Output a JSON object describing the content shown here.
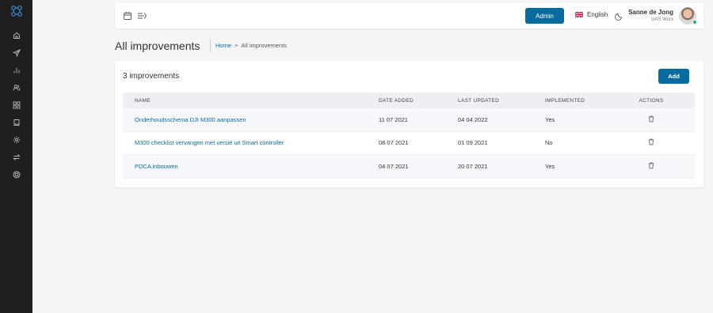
{
  "colors": {
    "accent": "#0a6b9e",
    "sidebar_bg": "#1f1f1f",
    "logo": "#3a8fd6"
  },
  "sidebar": {
    "logo_icon": "cluster-logo-icon",
    "items": [
      {
        "icon": "home-icon"
      },
      {
        "icon": "send-icon"
      },
      {
        "icon": "bar-chart-icon"
      },
      {
        "icon": "users-icon"
      },
      {
        "icon": "grid-icon"
      },
      {
        "icon": "book-icon"
      },
      {
        "icon": "gear-icon"
      },
      {
        "icon": "swap-icon"
      },
      {
        "icon": "support-icon"
      }
    ]
  },
  "topbar": {
    "left_icons": [
      "calendar-icon",
      "drone-icon"
    ],
    "admin_label": "Admin",
    "language": "English",
    "user_name": "Sanne de Jong",
    "user_org": "UAS Worx"
  },
  "page": {
    "title": "All improvements",
    "breadcrumb": {
      "home": "Home",
      "separator": ">",
      "current": "All improvements"
    }
  },
  "card": {
    "count_label": "3 improvements",
    "add_label": "Add",
    "columns": [
      "NAME",
      "DATE ADDED",
      "LAST UPDATED",
      "IMPLEMENTED",
      "ACTIONS"
    ],
    "rows": [
      {
        "name": "Onderhoudsschema DJI M300 aanpassen",
        "date_added": "11 07 2021",
        "last_updated": "04 04 2022",
        "implemented": "Yes"
      },
      {
        "name": "M300 checklist vervangen met versie uit Smart controller",
        "date_added": "08 07 2021",
        "last_updated": "01 09 2021",
        "implemented": "No"
      },
      {
        "name": "PDCA inbouwen",
        "date_added": "04 07 2021",
        "last_updated": "20 07 2021",
        "implemented": "Yes"
      }
    ]
  }
}
